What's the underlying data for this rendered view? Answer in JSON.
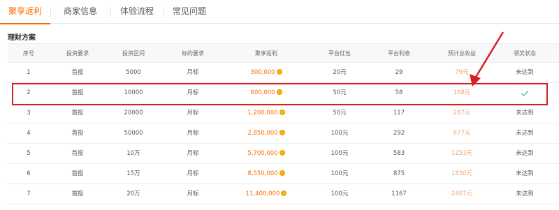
{
  "tabs": [
    {
      "label": "聚享返利",
      "active": true
    },
    {
      "label": "商家信息",
      "active": false
    },
    {
      "label": "体验流程",
      "active": false
    },
    {
      "label": "常见问题",
      "active": false
    }
  ],
  "section_title": "理财方案",
  "table": {
    "headers": [
      "序号",
      "投资要求",
      "投资区间",
      "标的要求",
      "聚享返利",
      "平台红包",
      "平台利息",
      "预计总收益",
      "领奖状态"
    ],
    "rows": [
      {
        "no": "1",
        "req": "首投",
        "range": "5000",
        "target": "月标",
        "rebate": "300,000",
        "redpack": "20元",
        "interest": "29",
        "total": "79元",
        "status": "未达到",
        "done": false
      },
      {
        "no": "2",
        "req": "首投",
        "range": "10000",
        "target": "月标",
        "rebate": "600,000",
        "redpack": "50元",
        "interest": "58",
        "total": "168元",
        "status": "",
        "done": true
      },
      {
        "no": "3",
        "req": "首投",
        "range": "20000",
        "target": "月标",
        "rebate": "1,200,000",
        "redpack": "50元",
        "interest": "117",
        "total": "287元",
        "status": "未达到",
        "done": false
      },
      {
        "no": "4",
        "req": "首投",
        "range": "50000",
        "target": "月标",
        "rebate": "2,850,000",
        "redpack": "100元",
        "interest": "292",
        "total": "677元",
        "status": "未达到",
        "done": false
      },
      {
        "no": "5",
        "req": "首投",
        "range": "10万",
        "target": "月标",
        "rebate": "5,700,000",
        "redpack": "100元",
        "interest": "583",
        "total": "1253元",
        "status": "未达到",
        "done": false
      },
      {
        "no": "6",
        "req": "首投",
        "range": "15万",
        "target": "月标",
        "rebate": "8,550,000",
        "redpack": "100元",
        "interest": "875",
        "total": "1830元",
        "status": "未达到",
        "done": false
      },
      {
        "no": "7",
        "req": "首投",
        "range": "20万",
        "target": "月标",
        "rebate": "11,400,000",
        "redpack": "100元",
        "interest": "1167",
        "total": "2407元",
        "status": "未达到",
        "done": false
      }
    ]
  },
  "colors": {
    "accent": "#ff6a00",
    "highlight": "#d62020",
    "check": "#2aa866"
  },
  "icons": [
    "coin-icon",
    "checkmark-icon",
    "annotation-arrow"
  ]
}
